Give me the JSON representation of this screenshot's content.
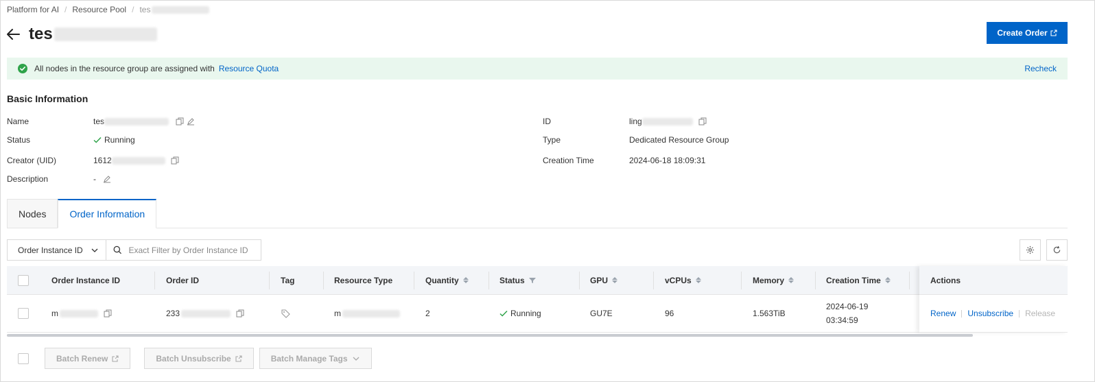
{
  "breadcrumb": {
    "items": [
      "Platform for AI",
      "Resource Pool",
      "tes"
    ],
    "separator": "/"
  },
  "header": {
    "title_prefix": "tes",
    "create_order_label": "Create Order"
  },
  "alert": {
    "message": "All nodes in the resource group are assigned with",
    "link_label": "Resource Quota",
    "recheck_label": "Recheck"
  },
  "basic_info": {
    "title": "Basic Information",
    "name_label": "Name",
    "name_value": "tes",
    "status_label": "Status",
    "status_value": "Running",
    "creator_label": "Creator (UID)",
    "creator_value": "1612",
    "description_label": "Description",
    "description_value": "-",
    "id_label": "ID",
    "id_value": "ling",
    "type_label": "Type",
    "type_value": "Dedicated Resource Group",
    "creation_time_label": "Creation Time",
    "creation_time_value": "2024-06-18 18:09:31"
  },
  "tabs": [
    {
      "label": "Nodes"
    },
    {
      "label": "Order Information"
    }
  ],
  "filter": {
    "select_value": "Order Instance ID",
    "search_placeholder": "Exact Filter by Order Instance ID"
  },
  "table": {
    "columns": [
      "Order Instance ID",
      "Order ID",
      "Tag",
      "Resource Type",
      "Quantity",
      "Status",
      "GPU",
      "vCPUs",
      "Memory",
      "Creation Time",
      "Actions"
    ],
    "row": {
      "order_instance_id": "m",
      "order_id": "233",
      "resource_type": "m",
      "quantity": "2",
      "status": "Running",
      "gpu": "GU7E",
      "vcpus": "96",
      "memory": "1.563TiB",
      "creation_date": "2024-06-19",
      "creation_time": "03:34:59",
      "actions": [
        "Renew",
        "Unsubscribe",
        "Release"
      ]
    }
  },
  "bottom_actions": {
    "batch_renew": "Batch Renew",
    "batch_unsubscribe": "Batch Unsubscribe",
    "batch_manage_tags": "Batch Manage Tags"
  },
  "colors": {
    "primary": "#0064c8",
    "success": "#2fa34a",
    "alert_bg": "#e9f7ee"
  }
}
